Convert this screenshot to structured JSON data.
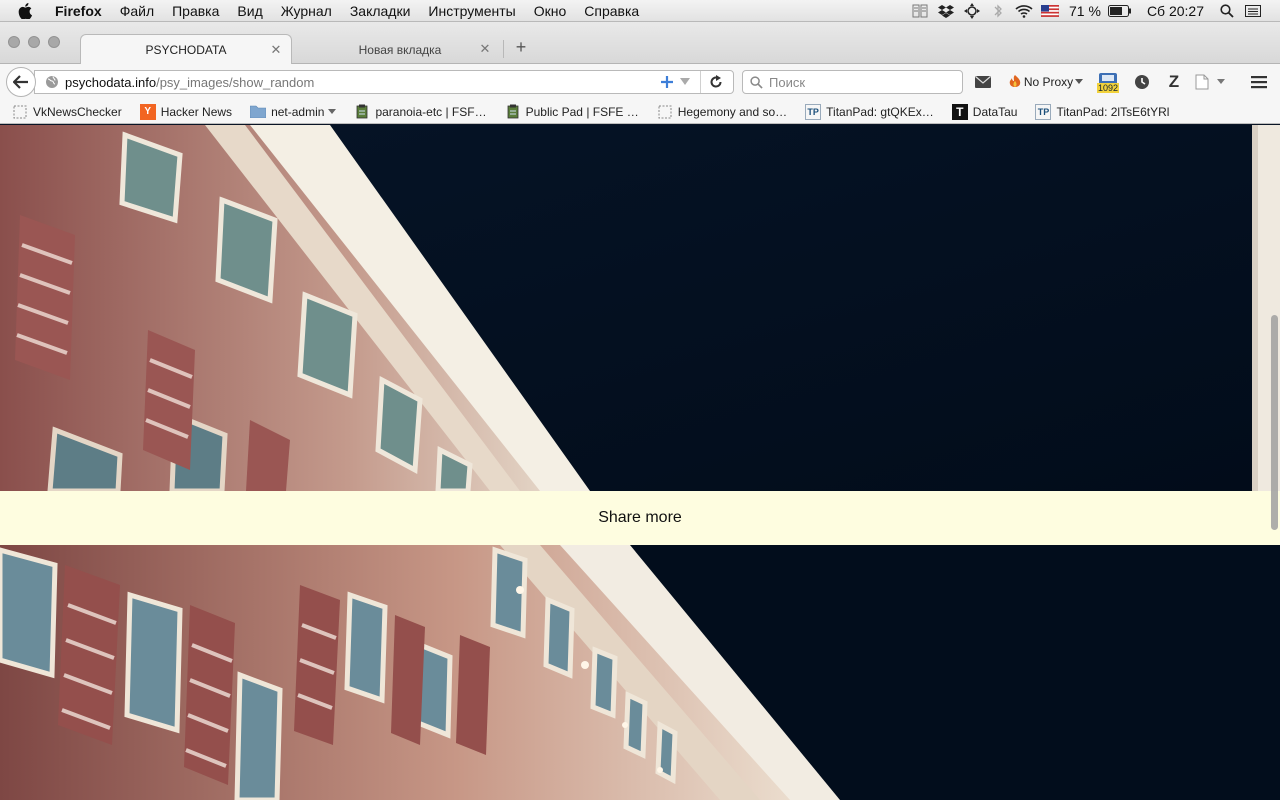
{
  "menubar": {
    "app_name": "Firefox",
    "items": [
      "Файл",
      "Правка",
      "Вид",
      "Журнал",
      "Закладки",
      "Инструменты",
      "Окно",
      "Справка"
    ],
    "battery": "71 %",
    "clock": "Сб 20:27",
    "icons": [
      "apple-icon",
      "stacks-icon",
      "dropbox-icon",
      "move-icon",
      "bluetooth-icon",
      "wifi-icon",
      "us-flag-icon",
      "battery-icon",
      "spotlight-icon",
      "list-icon"
    ]
  },
  "tabs": [
    {
      "title": "PSYCHODATA",
      "active": true
    },
    {
      "title": "Новая вкладка",
      "active": false
    }
  ],
  "navbar": {
    "url_host": "psychodata.info",
    "url_path": "/psy_images/show_random",
    "search_placeholder": "Поиск",
    "proxy_label": "No Proxy",
    "counter": "1092"
  },
  "bookmarks": [
    {
      "label": "VkNewsChecker",
      "icon": "dashed-box-icon"
    },
    {
      "label": "Hacker News",
      "icon": "hacker-news-icon"
    },
    {
      "label": "net-admin",
      "icon": "folder-icon"
    },
    {
      "label": "paranoia-etc | FSF…",
      "icon": "pad-icon"
    },
    {
      "label": "Public Pad | FSFE …",
      "icon": "pad-icon"
    },
    {
      "label": "Hegemony and so…",
      "icon": "dashed-box-icon"
    },
    {
      "label": "TitanPad: gtQKEx…",
      "icon": "titanpad-icon"
    },
    {
      "label": "DataTau",
      "icon": "datatau-icon"
    },
    {
      "label": "TitanPad: 2lTsE6tYRl",
      "icon": "titanpad-icon"
    }
  ],
  "content": {
    "share_label": "Share more"
  },
  "colors": {
    "sky": "#03101f",
    "band": "#fefde0",
    "facade_brick": "#a86a68",
    "facade_light": "#f2ede0"
  }
}
